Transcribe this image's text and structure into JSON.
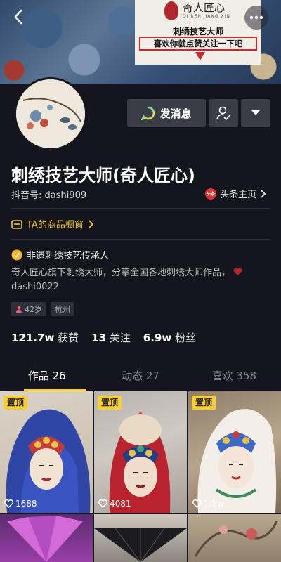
{
  "banner": {
    "logo_text": "奇人匠心",
    "logo_sub": "QI REN JIANG XIN",
    "poster_title": "刺绣技艺大师",
    "poster_slogan": "喜欢你就点赞关注一下吧"
  },
  "actions": {
    "message_label": "发消息"
  },
  "profile": {
    "name": "刺绣技艺大师(奇人匠心)",
    "douyin_id": "抖音号: dashi909",
    "toutiao_label": "头条主页",
    "toutiao_logo_text": "头条",
    "shop_label": "TA的商品橱窗",
    "verified_label": "非遗刺绣技艺传承人",
    "bio_line1": "奇人匠心旗下刺绣大师，分享全国各地刺绣大师作品，",
    "bio_line2": "dashi0022",
    "tag_age": "42岁",
    "tag_city": "杭州"
  },
  "stats": {
    "likes_num": "121.7w",
    "likes_label": "获赞",
    "following_num": "13",
    "following_label": "关注",
    "fans_num": "6.9w",
    "fans_label": "粉丝"
  },
  "tabs": [
    {
      "label": "作品 26"
    },
    {
      "label": "动态 27"
    },
    {
      "label": "喜欢 358"
    }
  ],
  "videos": [
    {
      "pinned": "置顶",
      "likes": "1688"
    },
    {
      "pinned": "置顶",
      "likes": "4081"
    },
    {
      "pinned": "置顶",
      "likes": "1.1w"
    }
  ],
  "colors": {
    "background": "#15161d",
    "accent_yellow": "#f9cf3b",
    "button_bg": "#3b3c45"
  }
}
